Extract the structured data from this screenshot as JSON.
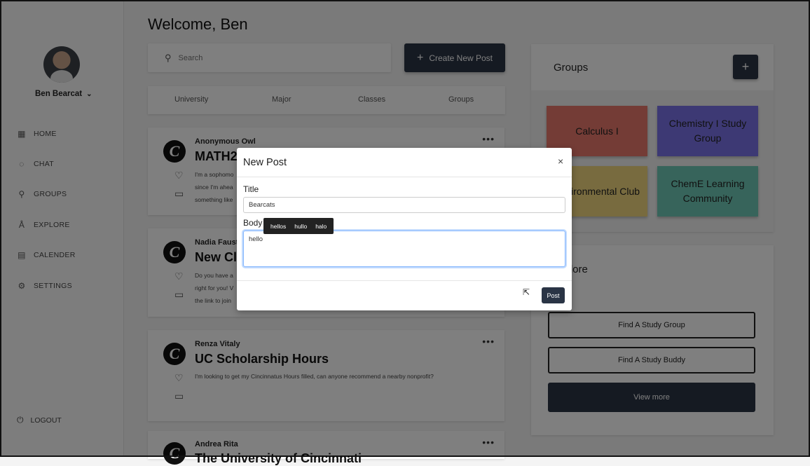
{
  "user": {
    "name": "Ben Bearcat"
  },
  "sidebar": {
    "items": [
      {
        "label": "HOME",
        "icon": "home-grid-icon"
      },
      {
        "label": "CHAT",
        "icon": "chat-bubble-icon"
      },
      {
        "label": "GROUPS",
        "icon": "person-icon"
      },
      {
        "label": "EXPLORE",
        "icon": "compass-icon"
      },
      {
        "label": "CALENDER",
        "icon": "calendar-icon"
      },
      {
        "label": "SETTINGS",
        "icon": "gear-icon"
      }
    ],
    "logout_label": "LOGOUT"
  },
  "header": {
    "welcome": "Welcome, Ben"
  },
  "search": {
    "placeholder": "Search"
  },
  "create_button": {
    "label": "Create New Post"
  },
  "filters": [
    "University",
    "Major",
    "Classes",
    "Groups"
  ],
  "posts": [
    {
      "author": "Anonymous Owl",
      "title": "MATH2",
      "body": [
        "I'm a sophomo",
        "since I'm ahea",
        "something like"
      ]
    },
    {
      "author": "Nadia Faust",
      "title": "New Cl",
      "body": [
        "Do you have a",
        "right for you! V",
        "the link to join"
      ]
    },
    {
      "author": "Renza Vitaly",
      "title": "UC Scholarship Hours",
      "body": [
        "I'm looking to get my Cincinnatus Hours filled, can anyone recommend a nearby nonprofit?"
      ]
    },
    {
      "author": "Andrea Rita",
      "title": "The University of Cincinnati"
    }
  ],
  "groups": {
    "title": "Groups",
    "add_label": "+",
    "tiles": [
      {
        "name": "Calculus I",
        "color": "#e8796c"
      },
      {
        "name": "Chemistry I Study Group",
        "color": "#7a73e8"
      },
      {
        "name": "Environmental Club",
        "color": "#f0d77f"
      },
      {
        "name": "ChemE Learning Community",
        "color": "#6fc9b6"
      }
    ]
  },
  "explore": {
    "title": "Explore",
    "buttons": [
      "Find A Study Group",
      "Find A Study Buddy",
      "View more"
    ]
  },
  "modal": {
    "title": "New Post",
    "close": "×",
    "title_label": "Title",
    "title_value": "Bearcats",
    "body_label": "Body",
    "body_value": "hello",
    "suggestions": [
      "hellos",
      "hullo",
      "halo"
    ],
    "post_label": "Post"
  },
  "colors": {
    "accent": "#2a3445",
    "focus": "#86b7fe"
  }
}
